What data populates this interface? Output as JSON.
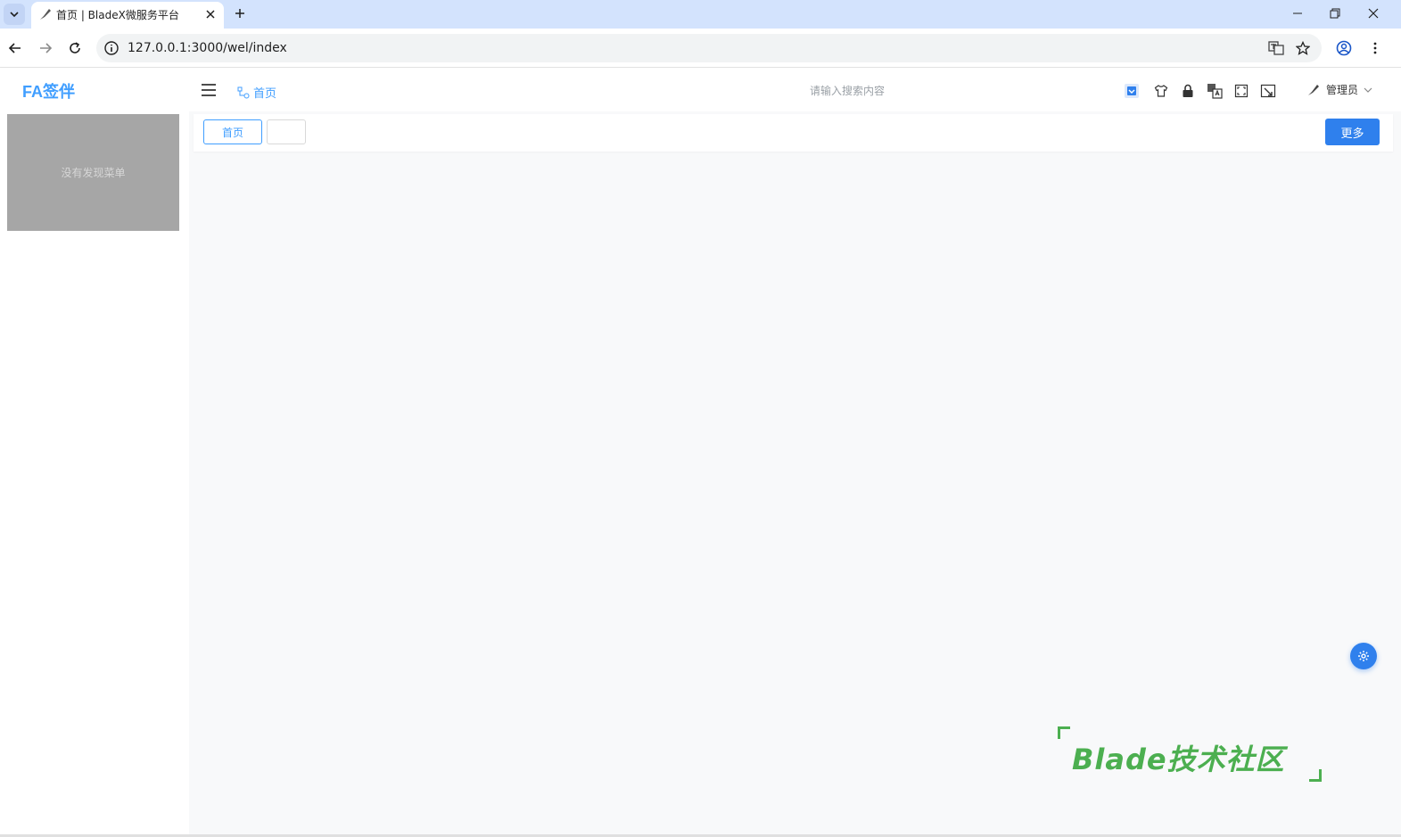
{
  "browser": {
    "tab_title": "首页 | BladeX微服务平台",
    "url": "127.0.0.1:3000/wel/index"
  },
  "app": {
    "logo": "FA签伴",
    "breadcrumb": "首页",
    "search_placeholder": "请输入搜索内容",
    "user_name": "管理员",
    "accent_color": "#409eff",
    "primary_button_color": "#2f80ed"
  },
  "sidebar": {
    "empty_text": "没有发现菜单"
  },
  "tags": {
    "home_label": "首页",
    "more_label": "更多"
  },
  "watermark": {
    "text": "Blade技术社区"
  },
  "icons": {
    "header": [
      "theme-color-icon",
      "shirt-icon",
      "lock-icon",
      "translate-icon",
      "fullscreen-icon",
      "screenshot-icon"
    ]
  }
}
